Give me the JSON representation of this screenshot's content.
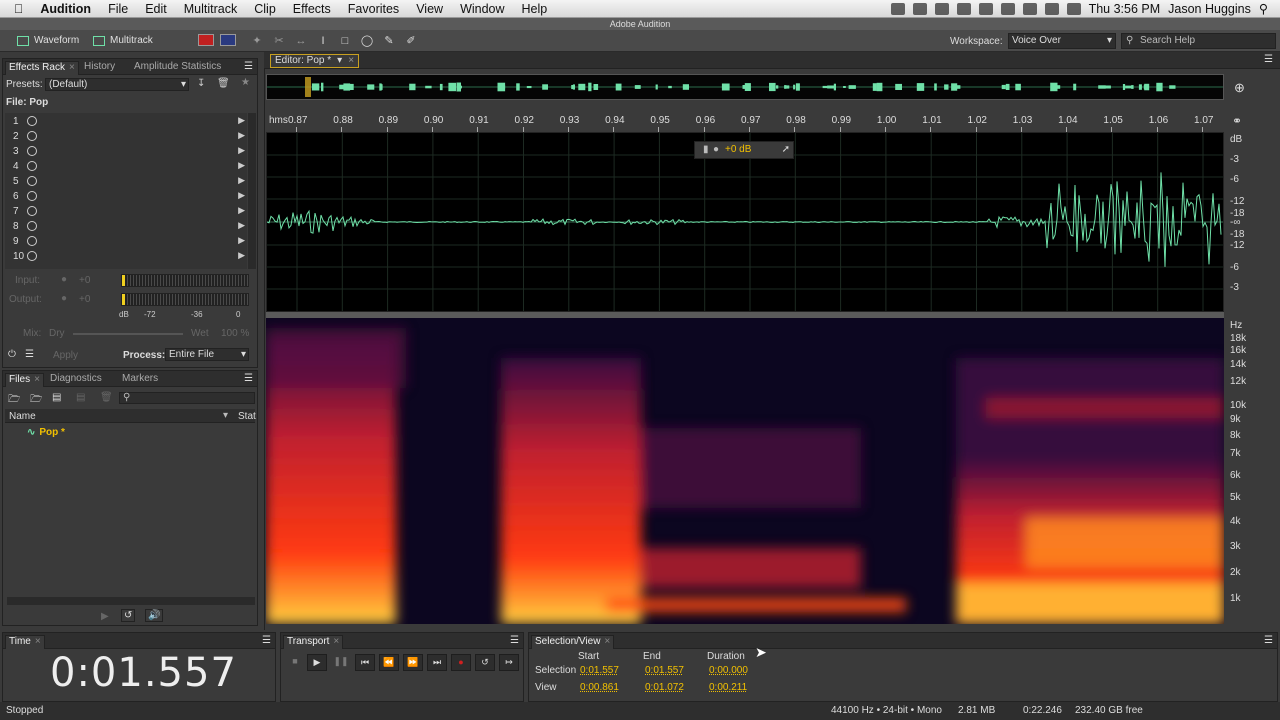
{
  "menubar": {
    "app": "Audition",
    "items": [
      "File",
      "Edit",
      "Multitrack",
      "Clip",
      "Effects",
      "Favorites",
      "View",
      "Window",
      "Help"
    ],
    "clock": "Thu 3:56 PM",
    "user": "Jason Huggins"
  },
  "window_title": "Adobe Audition",
  "toolbar": {
    "waveform": "Waveform",
    "multitrack": "Multitrack",
    "workspace_label": "Workspace:",
    "workspace_value": "Voice Over",
    "search_placeholder": "Search Help"
  },
  "effects_panel": {
    "tabs": [
      "Effects Rack",
      "History",
      "Amplitude Statistics"
    ],
    "presets_label": "Presets:",
    "presets_value": "(Default)",
    "file_label": "File: Pop",
    "slots": [
      "1",
      "2",
      "3",
      "4",
      "5",
      "6",
      "7",
      "8",
      "9",
      "10"
    ],
    "input_label": "Input:",
    "input_value": "+0",
    "output_label": "Output:",
    "output_value": "+0",
    "meter_scale": [
      "dB",
      "-72",
      "-36",
      "0"
    ],
    "mix_label": "Mix:",
    "dry_label": "Dry",
    "wet_label": "Wet",
    "wet_value": "100 %",
    "apply_label": "Apply",
    "process_label": "Process:",
    "process_value": "Entire File"
  },
  "files_panel": {
    "tabs": [
      "Files",
      "Diagnostics",
      "Markers"
    ],
    "col_name": "Name",
    "col_status": "Stat",
    "items": [
      "Pop *"
    ]
  },
  "editor": {
    "tab": "Editor: Pop *",
    "ruler_unit": "hms",
    "ruler_ticks": [
      "0.87",
      "0.88",
      "0.89",
      "0.90",
      "0.91",
      "0.92",
      "0.93",
      "0.94",
      "0.95",
      "0.96",
      "0.97",
      "0.98",
      "0.99",
      "1.00",
      "1.01",
      "1.02",
      "1.03",
      "1.04",
      "1.05",
      "1.06",
      "1.07"
    ],
    "db_scale": [
      "dB",
      "-3",
      "-6",
      "-12",
      "-18",
      "-∞",
      "-18",
      "-12",
      "-6",
      "-3"
    ],
    "hz_scale": [
      "Hz",
      "18k",
      "16k",
      "14k",
      "12k",
      "10k",
      "9k",
      "8k",
      "7k",
      "6k",
      "5k",
      "4k",
      "3k",
      "2k",
      "1k"
    ],
    "hud_value": "+0 dB"
  },
  "time_panel": {
    "title": "Time",
    "value": "0:01.557"
  },
  "transport_panel": {
    "title": "Transport"
  },
  "selection_view": {
    "title": "Selection/View",
    "headers": [
      "Start",
      "End",
      "Duration"
    ],
    "rows": [
      {
        "label": "Selection",
        "start": "0:01.557",
        "end": "0:01.557",
        "duration": "0:00.000"
      },
      {
        "label": "View",
        "start": "0:00.861",
        "end": "0:01.072",
        "duration": "0:00.211"
      }
    ]
  },
  "status": {
    "state": "Stopped",
    "format": "44100 Hz • 24-bit • Mono",
    "size": "2.81 MB",
    "duration": "0:22.246",
    "free": "232.40 GB free"
  },
  "colors": {
    "accent": "#f2c000",
    "waveform": "#6fe0a8",
    "spectral_hot": "#ff4a10"
  }
}
